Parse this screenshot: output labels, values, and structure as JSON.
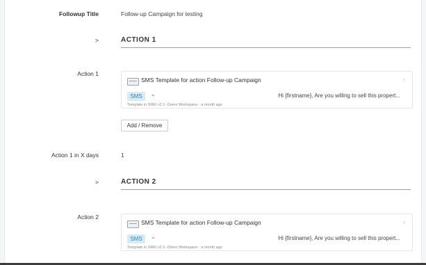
{
  "followup": {
    "label": "Followup Title",
    "value": "Follow-up Campaign for testing"
  },
  "section1": {
    "toggle": ">",
    "title": "ACTION 1"
  },
  "action1": {
    "label": "Action 1",
    "template_title": "SMS Template for action Follow-up Campaign",
    "channel": "SMS",
    "message": "Hi {firstname}, Are you willing to sell this propert...",
    "meta": "Template in SREI v2.1- Demo Workspace · a month ago",
    "add_remove": "Add / Remove",
    "chevron_right": "›",
    "chevron_down": "⌄"
  },
  "days": {
    "label": "Action 1 in X days",
    "value": "1"
  },
  "section2": {
    "toggle": ">",
    "title": "ACTION 2"
  },
  "action2": {
    "label": "Action 2",
    "template_title": "SMS Template for action Follow-up Campaign",
    "channel": "SMS",
    "message": "Hi {firstname}, Are you willing to sell this propert...",
    "meta": "Template in SREI v2.1- Demo Workspace · a month ago",
    "chevron_right": "›",
    "chevron_down": "⌄"
  }
}
